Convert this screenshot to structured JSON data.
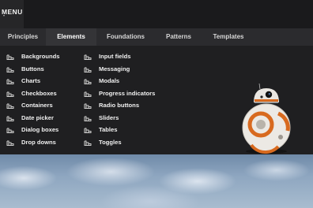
{
  "header": {
    "menu_label": "MENU"
  },
  "tabs": [
    {
      "label": "Principles",
      "active": false
    },
    {
      "label": "Elements",
      "active": true
    },
    {
      "label": "Foundations",
      "active": false
    },
    {
      "label": "Patterns",
      "active": false
    },
    {
      "label": "Templates",
      "active": false
    }
  ],
  "elements_menu": {
    "icon": "component-icon",
    "column_1": [
      "Backgrounds",
      "Buttons",
      "Charts",
      "Checkboxes",
      "Containers",
      "Date picker",
      "Dialog boxes",
      "Drop downs"
    ],
    "column_2": [
      "Input fields",
      "Messaging",
      "Modals",
      "Progress indicators",
      "Radio buttons",
      "Sliders",
      "Tables",
      "Toggles"
    ]
  },
  "colors": {
    "topbar": "#1a1a1c",
    "tabbar": "#2b2b2e",
    "panel": "#1f1f21",
    "droid_accent": "#d86a1f"
  }
}
